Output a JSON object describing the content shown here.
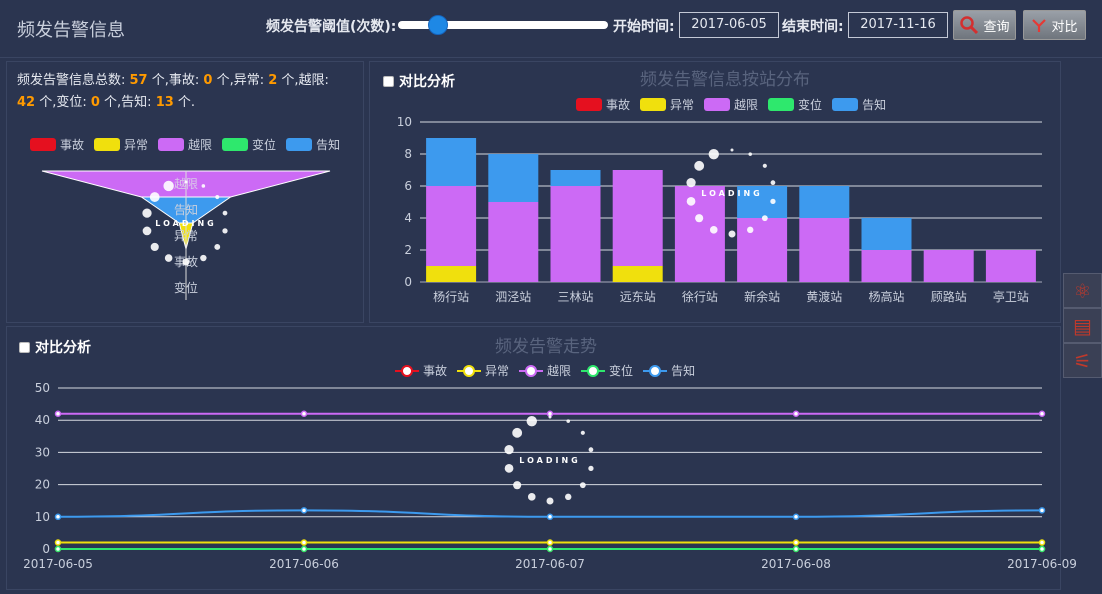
{
  "header": {
    "title": "频发告警信息",
    "threshold_label": "频发告警阈值(次数):",
    "threshold_value": 0.16,
    "start_label": "开始时间:",
    "start_date": "2017-06-05",
    "end_label": "结束时间:",
    "end_date": "2017-11-16",
    "query_label": "查询",
    "compare_label": "对比"
  },
  "summary": {
    "p1": "频发告警信息总数: ",
    "total": "57",
    "p2": " 个,事故: ",
    "accident": "0",
    "p3": " 个,异常: ",
    "abnormal": "2",
    "p4": " 个,越限: ",
    "overlimit": "42",
    "p5": " 个,变位: ",
    "shift": "0",
    "p6": " 个,告知: ",
    "notice": "13",
    "p7": " 个."
  },
  "legend": [
    {
      "label": "事故",
      "color": "#e5101f"
    },
    {
      "label": "异常",
      "color": "#f0e00d"
    },
    {
      "label": "越限",
      "color": "#cc6af5"
    },
    {
      "label": "变位",
      "color": "#2ee86d"
    },
    {
      "label": "告知",
      "color": "#3d9aee"
    }
  ],
  "funnel": {
    "labels": [
      "越限",
      "告知",
      "异常",
      "事故",
      "变位"
    ],
    "loading": "LOADING"
  },
  "bar_panel": {
    "compare_label": "对比分析",
    "title": "频发告警信息按站分布",
    "loading": "LOADING"
  },
  "line_panel": {
    "compare_label": "对比分析",
    "title": "频发告警走势",
    "loading": "LOADING"
  },
  "side_tools": [
    "atom-icon",
    "layers-icon",
    "chart-icon"
  ],
  "chart_data": [
    {
      "type": "funnel",
      "categories": [
        "越限",
        "告知",
        "异常",
        "事故",
        "变位"
      ],
      "values": [
        42,
        13,
        2,
        0,
        0
      ]
    },
    {
      "type": "bar",
      "stacked": true,
      "title": "频发告警信息按站分布",
      "categories": [
        "杨行站",
        "泗泾站",
        "三林站",
        "远东站",
        "徐行站",
        "新余站",
        "黄渡站",
        "杨高站",
        "顾路站",
        "亭卫站"
      ],
      "series": [
        {
          "name": "事故",
          "color": "#e5101f",
          "values": [
            0,
            0,
            0,
            0,
            0,
            0,
            0,
            0,
            0,
            0
          ]
        },
        {
          "name": "异常",
          "color": "#f0e00d",
          "values": [
            1,
            0,
            0,
            1,
            0,
            0,
            0,
            0,
            0,
            0
          ]
        },
        {
          "name": "越限",
          "color": "#cc6af5",
          "values": [
            5,
            5,
            6,
            6,
            6,
            4,
            4,
            2,
            2,
            2
          ]
        },
        {
          "name": "变位",
          "color": "#2ee86d",
          "values": [
            0,
            0,
            0,
            0,
            0,
            0,
            0,
            0,
            0,
            0
          ]
        },
        {
          "name": "告知",
          "color": "#3d9aee",
          "values": [
            3,
            3,
            1,
            0,
            0,
            2,
            2,
            2,
            0,
            0
          ]
        }
      ],
      "ylim": [
        0,
        10
      ],
      "yticks": [
        0,
        2,
        4,
        6,
        8,
        10
      ],
      "grid": true,
      "legend": "top"
    },
    {
      "type": "line",
      "title": "频发告警走势",
      "x": [
        "2017-06-05",
        "2017-06-06",
        "2017-06-07",
        "2017-06-08",
        "2017-06-09"
      ],
      "series": [
        {
          "name": "事故",
          "color": "#e5101f",
          "values": [
            0,
            0,
            0,
            0,
            0
          ]
        },
        {
          "name": "异常",
          "color": "#f0e00d",
          "values": [
            2,
            2,
            2,
            2,
            2
          ]
        },
        {
          "name": "越限",
          "color": "#cc6af5",
          "values": [
            42,
            42,
            42,
            42,
            42
          ]
        },
        {
          "name": "变位",
          "color": "#2ee86d",
          "values": [
            0,
            0,
            0,
            0,
            0
          ]
        },
        {
          "name": "告知",
          "color": "#3d9aee",
          "values": [
            10,
            12,
            10,
            10,
            12
          ]
        }
      ],
      "ylim": [
        0,
        50
      ],
      "yticks": [
        0,
        10,
        20,
        30,
        40,
        50
      ],
      "grid": true,
      "legend": "top"
    }
  ]
}
